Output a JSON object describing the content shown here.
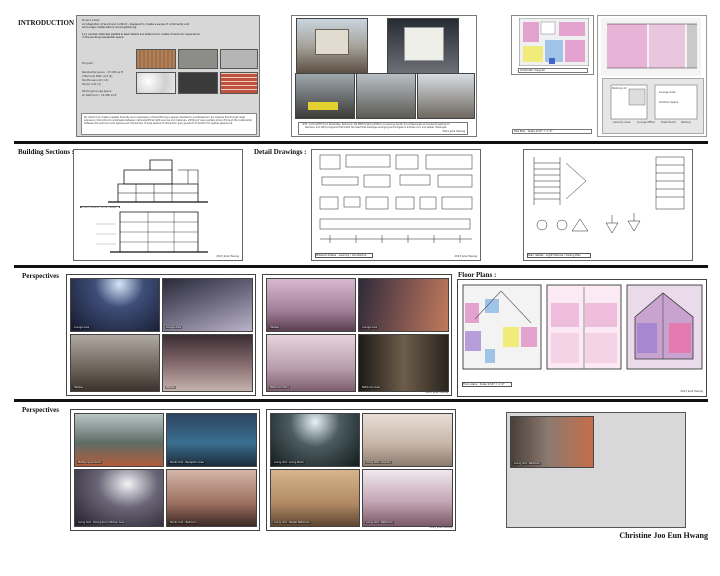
{
  "introduction": {
    "heading": "INTRODUCTION :",
    "project_intent_title": "Project intent:",
    "project_intent_text": "A) Integration of work and comfort - designed to create a sense of community and encourage collaboration/ social gathering.",
    "materials_text": "b) a neutral materials palette & best details are balanced to create a harmonic experience in the working residential space",
    "program_title": "Program:",
    "program_items": [
      "Residential space : 27,000 sq.ft",
      "2 Bed and Bath unit (4)",
      "Penthouse unit (1.4)",
      "Studio Unit (3)"
    ],
    "lounge_title": "Working/Lounge space",
    "lounge_items": [
      "w/ bathroom : 15,000 sq.ft"
    ],
    "statement_text": "My intent is to create a spatial diversity as an expression of transitioning a spaces devoted to a professional I am express this through steel exposure of structure to emphasize between natural/artificial light sources and materials. shifting of new quarters shown through the relationship between the solid and void spaces and intersection of lines spaces of interaction give guests for transition for spatial experience.",
    "photo_caption": "SITE : 1001 SIXTH Hoon Street Bay, Redmond, WA 98052 (Spring Edition) A Learning Center for professionals and students seeking for teachers, and effort programs that builds the heart that leverages emerging technologies to address civic and spatial challenges.",
    "plan_caption_1": "Schematic diagram",
    "plan_caption_2": "Site Plan : Scale 1/32\" = 1'-0\"",
    "plan_labels": [
      "Parking Lot",
      "Lounge Area",
      "Outdoor Space",
      "Laundry Area",
      "Lounge Office",
      "Trash Room",
      "Parking"
    ],
    "stamp": "2013 Julie Hwang"
  },
  "building_sections": {
    "heading": "Building Sections :",
    "caption": "Section Detail : Scale 3/32\"",
    "stamp": "2013 Julie Hwang"
  },
  "detail_drawings": {
    "heading": "Detail Drawings :",
    "caption_1": "Millwork details - Laundry / Countertop",
    "caption_2": "Stair details : Light fixtures / Ceiling Plan",
    "stamp": "2013 Julie Hwang"
  },
  "perspectives_1": {
    "heading": "Perspectives",
    "renders": [
      {
        "label": "Lounge Area"
      },
      {
        "label": "Lounge Area"
      },
      {
        "label": "Hallway"
      },
      {
        "label": "Kitchen"
      },
      {
        "label": "Hallway"
      },
      {
        "label": "Lounge Area"
      },
      {
        "label": "Bathroom Entry"
      },
      {
        "label": "Bathroom Area"
      }
    ],
    "stamp": "2013 Julie Hwang"
  },
  "floor_plans": {
    "heading": "Floor Plans :",
    "caption": "Floor plans : Scale 1/16\" = 1'-0\"",
    "stamp": "2013 Julie Hwang"
  },
  "perspectives_2": {
    "heading": "Perspectives",
    "renders": [
      {
        "label": "Multipurpose Room"
      },
      {
        "label": "Studio Unit - Reception Area"
      },
      {
        "label": "Living Unit - Dining Room Kitchen Area"
      },
      {
        "label": "Studio Unit - Bedroom"
      },
      {
        "label": "Living Unit - Living Room"
      },
      {
        "label": "Living Unit - Laundry"
      },
      {
        "label": "Living Unit - Master Bathroom"
      },
      {
        "label": "Living Unit - Bathroom"
      },
      {
        "label": "Living Unit - Bedroom"
      }
    ],
    "stamp": "2013 Julie Hwang"
  },
  "author": "Christine Joo Eun Hwang"
}
